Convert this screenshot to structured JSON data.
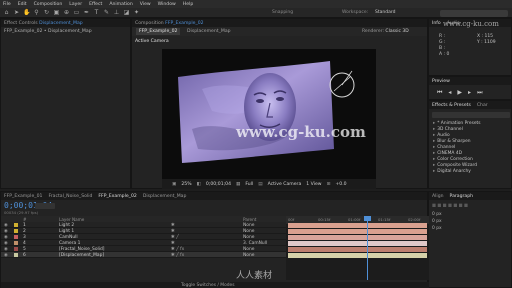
{
  "menu": [
    "File",
    "Edit",
    "Composition",
    "Layer",
    "Effect",
    "Animation",
    "View",
    "Window",
    "Help"
  ],
  "toolbar": {
    "snapping": "Snapping",
    "workspace_label": "Workspace:",
    "workspace_value": "Standard"
  },
  "effect_controls": {
    "tab": "Effect Controls",
    "tab_target": "Displacement_Map",
    "breadcrumb": "FFP_Example_02 • Displacement_Map"
  },
  "composition": {
    "tab": "Composition",
    "tab_target": "FFP_Example_02",
    "subtabs": [
      "FFP_Example_02",
      "Displacement_Map"
    ],
    "renderer_label": "Renderer:",
    "renderer_value": "Classic 3D",
    "camera_label": "Active Camera",
    "viewer_bar": {
      "zoom": "25%",
      "timecode": "0;00;01;04",
      "resolution": "Full",
      "camera": "Active Camera",
      "views": "1 View",
      "offset": "+0.0"
    }
  },
  "info": {
    "tabs": [
      "Info",
      "Audio"
    ],
    "rgb": [
      "R :",
      "G :",
      "B :",
      "A : 0"
    ],
    "xy": [
      "X : 115",
      "Y : 1109"
    ]
  },
  "preview": {
    "tab": "Preview"
  },
  "effects_presets": {
    "tabs": [
      "Effects & Presets",
      "Char"
    ],
    "items": [
      "* Animation Presets",
      "3D Channel",
      "Audio",
      "Blur & Sharpen",
      "Channel",
      "CINEMA 4D",
      "Color Correction",
      "Composite Wizard",
      "Digital Anarchy"
    ]
  },
  "align": {
    "tabs": [
      "Align",
      "Paragraph"
    ],
    "rows": [
      "0 px",
      "0 px",
      "0 px"
    ]
  },
  "timeline": {
    "tabs": [
      "FFP_Example_01",
      "Fractal_Noise_Solid",
      "FFP_Example_02",
      "Displacement_Map"
    ],
    "timecode": "0;00;01;04",
    "fps": "00034 (29.97 fps)",
    "columns": {
      "num": "#",
      "name": "Layer Name",
      "parent": "Parent"
    },
    "layers": [
      {
        "num": "1",
        "name": "Light 2",
        "parent": "None"
      },
      {
        "num": "2",
        "name": "Light 1",
        "parent": "None"
      },
      {
        "num": "3",
        "name": "CamNull",
        "parent": "None"
      },
      {
        "num": "4",
        "name": "Camera 1",
        "parent": "3. CamNull"
      },
      {
        "num": "5",
        "name": "[Fractal_Noise_Solid]",
        "parent": "None"
      },
      {
        "num": "6",
        "name": "[Displacement_Map]",
        "parent": "None"
      }
    ],
    "ruler": [
      "00f",
      "00:15f",
      "01:00f",
      "01:15f",
      "02:00f"
    ],
    "current_frame": 34,
    "frames_visible": 60,
    "footer": "Toggle Switches / Modes"
  },
  "watermarks": {
    "center": "www.cg-ku.com",
    "top_right": "www.cg-ku.com",
    "footer_cn": "人人素材"
  },
  "colors": {
    "accent": "#4f90d8",
    "layer_labels": [
      "#d0b030",
      "#d0b030",
      "#c86060",
      "#c0906a",
      "#9a4a4a",
      "#c8c8a0"
    ],
    "track_bars": [
      "#d9a08f",
      "#d9a08f",
      "#d8a49a",
      "#e0c8c8",
      "#bd7e6e",
      "#d6d1a9"
    ]
  }
}
